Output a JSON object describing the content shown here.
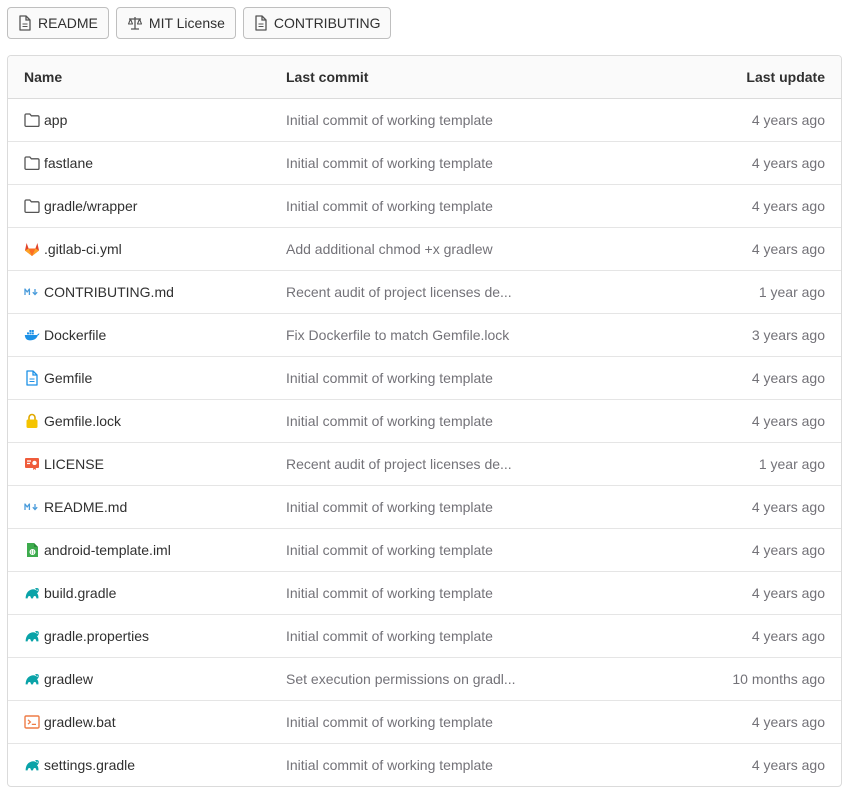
{
  "badges": [
    {
      "label": "README",
      "icon": "file-icon"
    },
    {
      "label": "MIT License",
      "icon": "scale-icon"
    },
    {
      "label": "CONTRIBUTING",
      "icon": "file-icon"
    }
  ],
  "table": {
    "headers": {
      "name": "Name",
      "commit": "Last commit",
      "date": "Last update"
    },
    "rows": [
      {
        "name": "app",
        "icon": "folder-icon",
        "commit": "Initial commit of working template",
        "date": "4 years ago"
      },
      {
        "name": "fastlane",
        "icon": "folder-icon",
        "commit": "Initial commit of working template",
        "date": "4 years ago"
      },
      {
        "name": "gradle/wrapper",
        "icon": "folder-icon",
        "commit": "Initial commit of working template",
        "date": "4 years ago"
      },
      {
        "name": ".gitlab-ci.yml",
        "icon": "gitlab-icon",
        "commit": "Add additional chmod +x gradlew",
        "date": "4 years ago"
      },
      {
        "name": "CONTRIBUTING.md",
        "icon": "markdown-icon",
        "commit": "Recent audit of project licenses de...",
        "date": "1 year ago"
      },
      {
        "name": "Dockerfile",
        "icon": "docker-icon",
        "commit": "Fix Dockerfile to match Gemfile.lock",
        "date": "3 years ago"
      },
      {
        "name": "Gemfile",
        "icon": "file-icon",
        "commit": "Initial commit of working template",
        "date": "4 years ago"
      },
      {
        "name": "Gemfile.lock",
        "icon": "lock-icon",
        "commit": "Initial commit of working template",
        "date": "4 years ago"
      },
      {
        "name": "LICENSE",
        "icon": "license-icon",
        "commit": "Recent audit of project licenses de...",
        "date": "1 year ago"
      },
      {
        "name": "README.md",
        "icon": "markdown-icon",
        "commit": "Initial commit of working template",
        "date": "4 years ago"
      },
      {
        "name": "android-template.iml",
        "icon": "android-file-icon",
        "commit": "Initial commit of working template",
        "date": "4 years ago"
      },
      {
        "name": "build.gradle",
        "icon": "gradle-icon",
        "commit": "Initial commit of working template",
        "date": "4 years ago"
      },
      {
        "name": "gradle.properties",
        "icon": "gradle-icon",
        "commit": "Initial commit of working template",
        "date": "4 years ago"
      },
      {
        "name": "gradlew",
        "icon": "gradle-icon",
        "commit": "Set execution permissions on gradl...",
        "date": "10 months ago"
      },
      {
        "name": "gradlew.bat",
        "icon": "terminal-icon",
        "commit": "Initial commit of working template",
        "date": "4 years ago"
      },
      {
        "name": "settings.gradle",
        "icon": "gradle-icon",
        "commit": "Initial commit of working template",
        "date": "4 years ago"
      }
    ]
  },
  "colors": {
    "text": "#303030",
    "muted": "#737278",
    "border": "#dbdbdb",
    "header_bg": "#fafafa",
    "gitlab": "#e24329",
    "markdown": "#4a9cdb",
    "docker": "#1d91e6",
    "lock": "#f5c400",
    "license": "#ef5c3b",
    "android": "#3dab4d",
    "gradle": "#0aa3a8",
    "terminal": "#ee7c46"
  }
}
